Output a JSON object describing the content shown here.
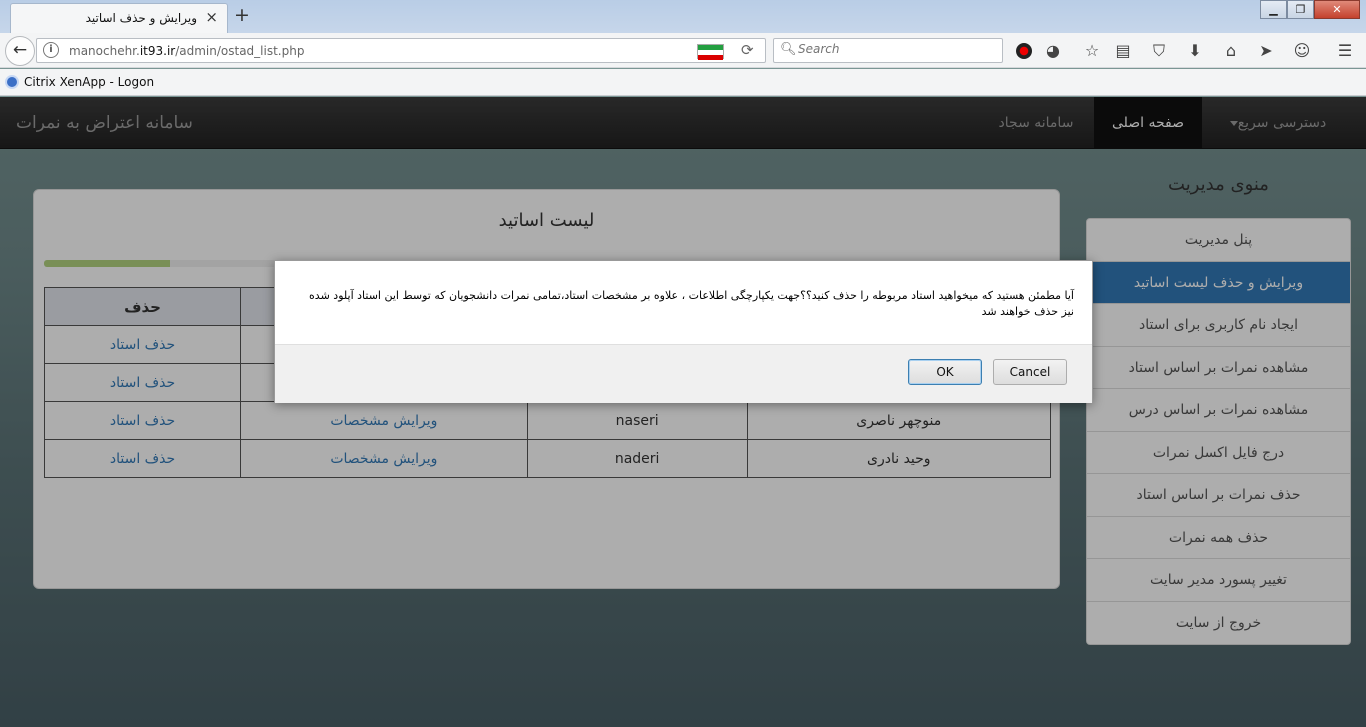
{
  "browser": {
    "tab_title": "ویرایش و حذف اساتید",
    "tab_close": "×",
    "new_tab": "+",
    "back": "←",
    "info": "i",
    "url_prefix": "manochehr.",
    "url_domain": "it93.ir",
    "url_path": "/admin/ostad_list.php",
    "search_placeholder": "Search",
    "bookmark": "Citrix XenApp - Logon",
    "window_buttons": [
      "▁",
      "❐",
      "✕"
    ]
  },
  "site": {
    "brand": "سامانه اعتراض به نمرات",
    "nav": {
      "quick_access": "دسترسی سریع",
      "home": "صفحه اصلی",
      "sajad": "سامانه سجاد"
    }
  },
  "panel": {
    "title": "لیست اساتید",
    "progress": 0.125,
    "columns": [
      "",
      "",
      "",
      "حذف"
    ],
    "rows": [
      {
        "name": "",
        "username": "",
        "edit": "",
        "delete": "حذف استاد"
      },
      {
        "name": "",
        "username": "",
        "edit": "",
        "delete": "حذف استاد"
      },
      {
        "name": "منوچهر ناصری",
        "username": "naseri",
        "edit": "ویرایش مشخصات",
        "delete": "حذف استاد"
      },
      {
        "name": "وحید نادری",
        "username": "naderi",
        "edit": "ویرایش مشخصات",
        "delete": "حذف استاد"
      }
    ]
  },
  "sidebar": {
    "title": "منوی مدیریت",
    "items": [
      "پنل مدیریت",
      "ویرایش و حذف لیست اساتید",
      "ایجاد نام کاربری برای استاد",
      "مشاهده نمرات بر اساس استاد",
      "مشاهده نمرات بر اساس درس",
      "درج فایل اکسل نمرات",
      "حذف نمرات بر اساس استاد",
      "حذف همه نمرات",
      "تغییر پسورد مدیر سایت",
      "خروج از سایت"
    ],
    "active_index": 1
  },
  "dialog": {
    "message": "آیا مطمئن هستید که میخواهید استاد مربوطه را حذف کنید؟؟جهت یکپارچگی اطلاعات ، علاوه بر مشخصات استاد،تمامی نمرات دانشجویان که توسط این استاد آپلود شده نیز حذف خواهند شد",
    "ok": "OK",
    "cancel": "Cancel"
  },
  "colors": {
    "accent": "#337ab7",
    "navbar": "#222222",
    "progress": "#b3d37f"
  }
}
